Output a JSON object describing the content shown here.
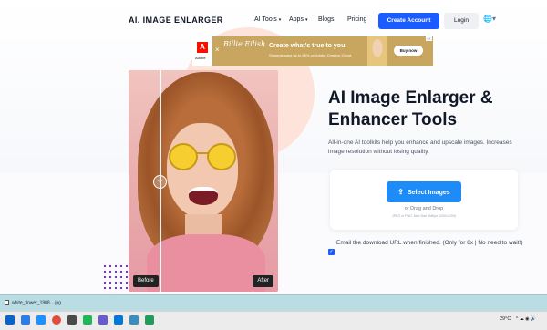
{
  "nav": {
    "logo": "AI. IMAGE ENLARGER",
    "items": [
      {
        "label": "AI Tools",
        "caret": "▾"
      },
      {
        "label": "Apps",
        "caret": "▾"
      },
      {
        "label": "Blogs"
      },
      {
        "label": "Pricing"
      }
    ],
    "create_account": "Create Account",
    "login": "Login",
    "language": "🌐▾"
  },
  "ad": {
    "adobe_letter": "A",
    "adobe_word": "Adobe",
    "x": "×",
    "signature": "Billie Eilish",
    "headline": "Create what's true to you.",
    "sub": "Students save up to 65% on Adobe Creative Cloud.",
    "buy": "Buy now",
    "adtag": "i ✕"
  },
  "photo": {
    "before_label": "Before",
    "after_label": "After",
    "handle": "‹›"
  },
  "hero": {
    "title": "AI Image Enlarger & Enhancer Tools",
    "description": "All-in-one AI toolkits help you enhance and upscale images. Increases image resolution without losing quality."
  },
  "upload": {
    "select_label": "Select Images",
    "select_icon": "⇪",
    "drag_text": "or Drag and Drop",
    "limits": "JPEG or PNG, Max Size 5Mb(or 1200×1200)"
  },
  "email": {
    "text": "Email the download URL when finished. (Only for 8x | No need to wait!)",
    "checked": true,
    "check_glyph": "✓"
  },
  "downloads": {
    "file": "white_flower_1988....jpg"
  },
  "taskbar": {
    "temperature": "29°C",
    "tray": "^ ☁ ◉ 🔊",
    "time": "",
    "icon_colors": [
      "#0a64c8",
      "#2b7de9",
      "#1e90ff",
      "#e14b3b",
      "#4a4a4a",
      "#1db954",
      "#6a5acd",
      "#0078d7",
      "#3c8dbc",
      "#1e9e5a"
    ]
  }
}
